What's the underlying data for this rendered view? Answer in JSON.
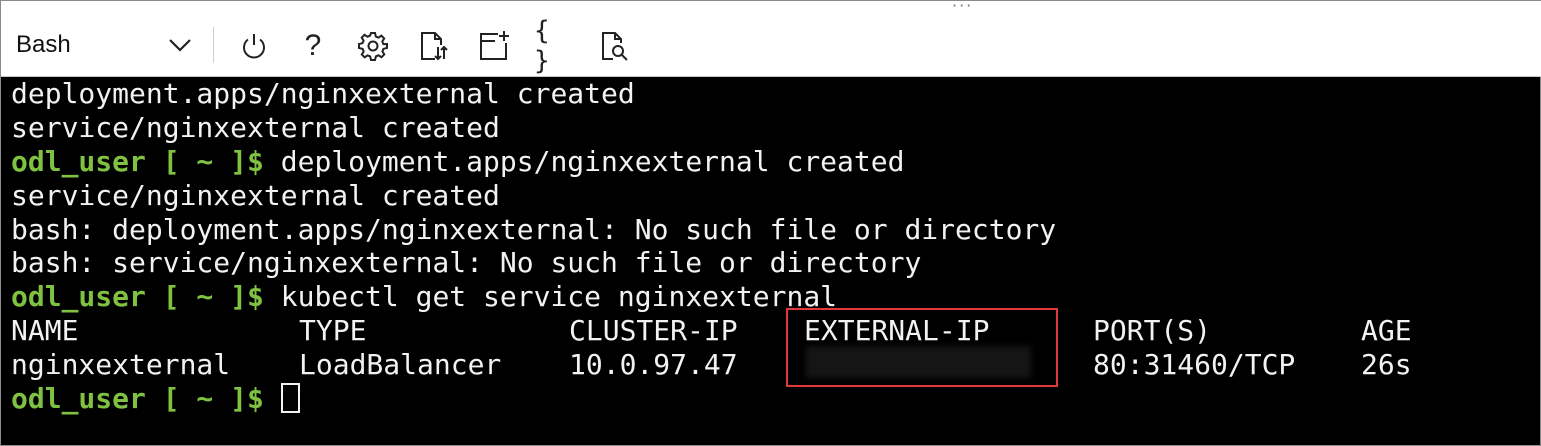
{
  "toolbar": {
    "shell": "Bash",
    "grip": "···",
    "icons": [
      "power-icon",
      "help-icon",
      "settings-icon",
      "upload-download-icon",
      "new-session-icon",
      "editor-braces-icon",
      "web-preview-icon"
    ],
    "help_glyph": "?",
    "braces_glyph": "{ }"
  },
  "terminal": {
    "prompt": "odl_user [ ~ ]$",
    "lines": [
      "deployment.apps/nginxexternal created",
      "service/nginxexternal created",
      "deployment.apps/nginxexternal created",
      "service/nginxexternal created",
      "bash: deployment.apps/nginxexternal: No such file or directory",
      "bash: service/nginxexternal: No such file or directory",
      "kubectl get service nginxexternal"
    ],
    "table": {
      "headers": [
        "NAME",
        "TYPE",
        "CLUSTER-IP",
        "EXTERNAL-IP",
        "PORT(S)",
        "AGE"
      ],
      "row": [
        "nginxexternal",
        "LoadBalancer",
        "10.0.97.47",
        "",
        "80:31460/TCP",
        "26s"
      ]
    }
  },
  "colors": {
    "prompt": "#7fc241",
    "highlight": "#e0393b",
    "text": "#f2f2f2",
    "background": "#000000"
  }
}
